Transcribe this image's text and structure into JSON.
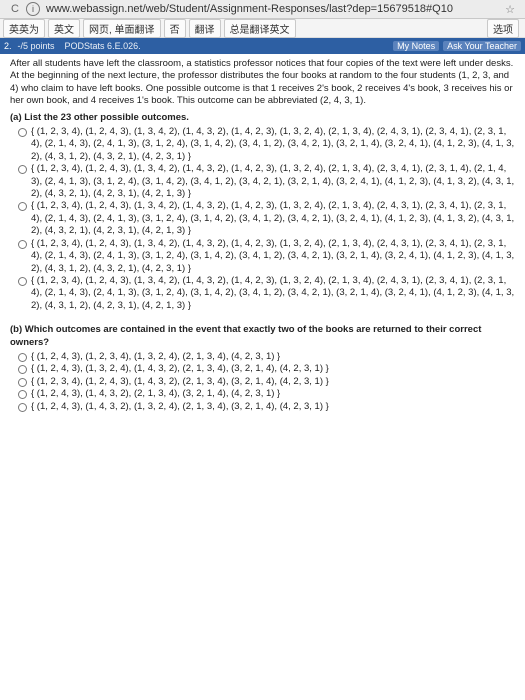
{
  "browser": {
    "back": "C",
    "info_glyph": "i",
    "url": "www.webassign.net/web/Student/Assignment-Responses/last?dep=15679518#Q10",
    "star": "☆"
  },
  "toolbar": {
    "buttons": [
      "英英为",
      "英文",
      "网页, 单面翻译",
      "否",
      "翻译",
      "总是翻译英文"
    ],
    "right": "选项"
  },
  "strip": {
    "qnum": "2.",
    "points": "-/5 points",
    "source": "PODStats 6.E.026.",
    "my_notes": "My Notes",
    "ask": "Ask Your Teacher"
  },
  "intro": "After all students have left the classroom, a statistics professor notices that four copies of the text were left under desks. At the beginning of the next lecture, the professor distributes the four books at random to the four students (1, 2, 3, and 4) who claim to have left books. One possible outcome is that 1 receives 2's book, 2 receives 4's book, 3 receives his or her own book, and 4 receives 1's book. This outcome can be abbreviated (2, 4, 3, 1).",
  "part_a": {
    "label": "(a) List the 23 other possible outcomes.",
    "options": [
      "{ (1, 2, 3, 4), (1, 2, 4, 3), (1, 3, 4, 2), (1, 4, 3, 2), (1, 4, 2, 3), (1, 3, 2, 4), (2, 1, 3, 4), (2, 4, 3, 1), (2, 3, 4, 1), (2, 3, 1, 4), (2, 1, 4, 3), (2, 4, 1, 3), (3, 1, 2, 4), (3, 1, 4, 2), (3, 4, 1, 2), (3, 4, 2, 1), (3, 2, 1, 4), (3, 2, 4, 1), (4, 1, 2, 3), (4, 1, 3, 2), (4, 3, 1, 2), (4, 3, 2, 1), (4, 2, 3, 1) }",
      "{ (1, 2, 3, 4), (1, 2, 4, 3), (1, 3, 4, 2), (1, 4, 3, 2), (1, 4, 2, 3), (1, 3, 2, 4), (2, 1, 3, 4), (2, 3, 4, 1), (2, 3, 1, 4), (2, 1, 4, 3), (2, 4, 1, 3), (3, 1, 2, 4), (3, 1, 4, 2), (3, 4, 1, 2), (3, 4, 2, 1), (3, 2, 1, 4), (3, 2, 4, 1), (4, 1, 2, 3), (4, 1, 3, 2), (4, 3, 1, 2), (4, 3, 2, 1), (4, 2, 3, 1), (4, 2, 1, 3) }",
      "{ (1, 2, 3, 4), (1, 2, 4, 3), (1, 3, 4, 2), (1, 4, 3, 2), (1, 4, 2, 3), (1, 3, 2, 4), (2, 1, 3, 4), (2, 4, 3, 1), (2, 3, 4, 1), (2, 3, 1, 4), (2, 1, 4, 3), (2, 4, 1, 3), (3, 1, 2, 4), (3, 1, 4, 2), (3, 4, 1, 2), (3, 4, 2, 1), (3, 2, 4, 1), (4, 1, 2, 3), (4, 1, 3, 2), (4, 3, 1, 2), (4, 3, 2, 1), (4, 2, 3, 1), (4, 2, 1, 3) }",
      "{ (1, 2, 3, 4), (1, 2, 4, 3), (1, 3, 4, 2), (1, 4, 3, 2), (1, 4, 2, 3), (1, 3, 2, 4), (2, 1, 3, 4), (2, 4, 3, 1), (2, 3, 4, 1), (2, 3, 1, 4), (2, 1, 4, 3), (2, 4, 1, 3), (3, 1, 2, 4), (3, 1, 4, 2), (3, 4, 1, 2), (3, 4, 2, 1), (3, 2, 1, 4), (3, 2, 4, 1), (4, 1, 2, 3), (4, 1, 3, 2), (4, 3, 1, 2), (4, 3, 2, 1), (4, 2, 3, 1) }",
      "{ (1, 2, 3, 4), (1, 2, 4, 3), (1, 3, 4, 2), (1, 4, 3, 2), (1, 4, 2, 3), (1, 3, 2, 4), (2, 1, 3, 4), (2, 4, 3, 1), (2, 3, 4, 1), (2, 3, 1, 4), (2, 1, 4, 3), (2, 4, 1, 3), (3, 1, 2, 4), (3, 1, 4, 2), (3, 4, 1, 2), (3, 4, 2, 1), (3, 2, 1, 4), (3, 2, 4, 1), (4, 1, 2, 3), (4, 1, 3, 2), (4, 3, 1, 2), (4, 2, 3, 1), (4, 2, 1, 3) }"
    ]
  },
  "part_b": {
    "label": "(b) Which outcomes are contained in the event that exactly two of the books are returned to their correct owners?",
    "options": [
      "{ (1, 2, 4, 3), (1, 2, 3, 4), (1, 3, 2, 4), (2, 1, 3, 4), (4, 2, 3, 1) }",
      "{ (1, 2, 4, 3), (1, 3, 2, 4), (1, 4, 3, 2), (2, 1, 3, 4), (3, 2, 1, 4), (4, 2, 3, 1) }",
      "{ (1, 2, 3, 4), (1, 2, 4, 3), (1, 4, 3, 2), (2, 1, 3, 4), (3, 2, 1, 4), (4, 2, 3, 1) }",
      "{ (1, 2, 4, 3), (1, 4, 3, 2), (2, 1, 3, 4), (3, 2, 1, 4), (4, 2, 3, 1) }",
      "{ (1, 2, 4, 3), (1, 4, 3, 2), (1, 3, 2, 4), (2, 1, 3, 4), (3, 2, 1, 4), (4, 2, 3, 1) }"
    ]
  }
}
